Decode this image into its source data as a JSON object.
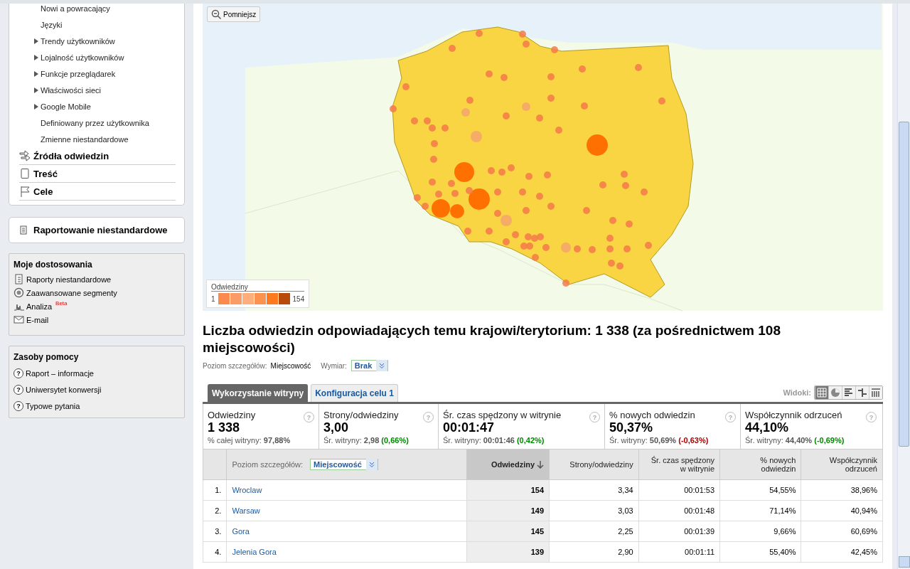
{
  "sidebar": {
    "report_items": [
      {
        "label": "Nowi a powracający",
        "kind": "plain"
      },
      {
        "label": "Języki",
        "kind": "plain"
      },
      {
        "label": "Trendy użytkowników",
        "kind": "expandable"
      },
      {
        "label": "Lojalność użytkowników",
        "kind": "expandable"
      },
      {
        "label": "Funkcje przeglądarek",
        "kind": "expandable"
      },
      {
        "label": "Właściwości sieci",
        "kind": "expandable"
      },
      {
        "label": "Google Mobile",
        "kind": "expandable"
      },
      {
        "label": "Definiowany przez użytkownika",
        "kind": "plain"
      },
      {
        "label": "Zmienne niestandardowe",
        "kind": "plain"
      }
    ],
    "sections": [
      {
        "label": "Źródła odwiedzin",
        "kind": "arrows"
      },
      {
        "label": "Treść",
        "kind": "page"
      },
      {
        "label": "Cele",
        "kind": "flag"
      }
    ],
    "custom_reporting": {
      "label": "Raportowanie niestandardowe"
    },
    "customizations": {
      "title": "Moje dostosowania",
      "items": [
        {
          "label": "Raporty niestandardowe",
          "kind": "report"
        },
        {
          "label": "Zaawansowane segmenty",
          "kind": "target"
        },
        {
          "label": "Analiza",
          "kind": "pulse",
          "badge": "Beta"
        },
        {
          "label": "E-mail",
          "kind": "mail"
        }
      ]
    },
    "help": {
      "title": "Zasoby pomocy",
      "items": [
        {
          "icon": "?",
          "label": "Raport – informacje"
        },
        {
          "icon": "?",
          "label": "Uniwersytet konwersji"
        },
        {
          "icon": "?",
          "label": "Typowe pytania"
        }
      ]
    }
  },
  "map": {
    "zoom_button": "Pomniejsz",
    "legend": {
      "title": "Odwiedziny",
      "min": "1",
      "max": "154"
    }
  },
  "title": "Liczba odwiedzin odpowiadających temu krajowi/terytorium: 1 338 (za pośrednictwem 108 miejscowości)",
  "filters": {
    "detail_label": "Poziom szczegółów:",
    "detail_value": "Miejscowość",
    "dimension_label": "Wymiar:",
    "dimension_value": "Brak"
  },
  "tabs": [
    {
      "label": "Wykorzystanie witryny",
      "selected": true
    },
    {
      "label": "Konfiguracja celu 1",
      "selected": false
    }
  ],
  "views": {
    "label": "Widoki:",
    "items": [
      {
        "kind": "table",
        "selected": true
      },
      {
        "kind": "pie",
        "selected": false
      },
      {
        "kind": "bars",
        "selected": false
      },
      {
        "kind": "compare",
        "selected": false
      },
      {
        "kind": "pivot",
        "selected": false
      }
    ]
  },
  "stats": [
    {
      "label": "Odwiedziny",
      "help": "?",
      "value": "1 338",
      "avg_label": "% całej witryny:",
      "avg": "97,88%"
    },
    {
      "label": "Strony/odwiedziny",
      "help": "?",
      "value": "3,00",
      "avg_label": "Śr. witryny:",
      "avg": "2,98",
      "delta": "(0,66%)",
      "positive": true
    },
    {
      "label": "Śr. czas spędzony w witrynie",
      "help": "?",
      "value": "00:01:47",
      "avg_label": "Śr. witryny:",
      "avg": "00:01:46",
      "delta": "(0,42%)",
      "positive": true
    },
    {
      "label": "% nowych odwiedzin",
      "help": "?",
      "value": "50,37%",
      "avg_label": "Śr. witryny:",
      "avg": "50,69%",
      "delta": "(-0,63%)",
      "positive": false
    },
    {
      "label": "Współczynnik odrzuceń",
      "help": "?",
      "value": "44,10%",
      "avg_label": "Śr. witryny:",
      "avg": "44,40%",
      "delta": "(-0,69%)",
      "positive": true
    }
  ],
  "table": {
    "detail_label": "Poziom szczegółów:",
    "detail_value": "Miejscowość",
    "columns": [
      {
        "label": "Odwiedziny",
        "sorted": true
      },
      {
        "label": "Strony/odwiedziny",
        "sorted": false
      },
      {
        "label": "Śr. czas spędzony w witrynie",
        "sorted": false
      },
      {
        "label": "% nowych odwiedzin",
        "sorted": false
      },
      {
        "label": "Współczynnik odrzuceń",
        "sorted": false
      }
    ],
    "rows": [
      {
        "rank": "1.",
        "city": "Wroclaw",
        "cells": [
          "154",
          "3,34",
          "00:01:53",
          "54,55%",
          "38,96%"
        ]
      },
      {
        "rank": "2.",
        "city": "Warsaw",
        "cells": [
          "149",
          "3,03",
          "00:01:48",
          "71,14%",
          "40,94%"
        ]
      },
      {
        "rank": "3.",
        "city": "Gora",
        "cells": [
          "145",
          "2,25",
          "00:01:39",
          "9,66%",
          "60,69%"
        ]
      },
      {
        "rank": "4.",
        "city": "Jelenia Gora",
        "cells": [
          "139",
          "2,90",
          "00:01:11",
          "55,40%",
          "42,45%"
        ]
      }
    ]
  }
}
